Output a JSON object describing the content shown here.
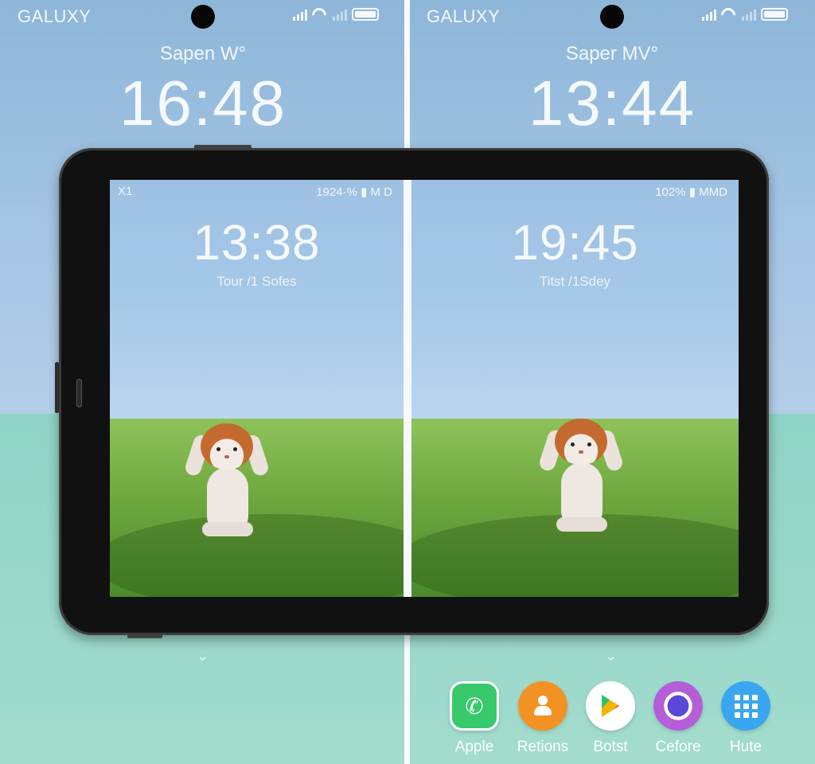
{
  "left_phone": {
    "brand": "GALUXY",
    "owner": "Sapen W°",
    "time": "16:48"
  },
  "right_phone": {
    "brand": "GALUXY",
    "owner": "Saper MV°",
    "time": "13:44"
  },
  "tablet": {
    "left_screen": {
      "status_left": "X1",
      "status_right": "1924·% ▮ M D",
      "time": "13:38",
      "date": "Tour /1 Sofes"
    },
    "right_screen": {
      "status_right": "102% ▮ MMD",
      "time": "19:45",
      "date": "Titst /1Sdey"
    }
  },
  "dock": {
    "apps": [
      {
        "label": "Apple",
        "icon": "phone-icon",
        "color": "#37c96b"
      },
      {
        "label": "Retions",
        "icon": "contacts-icon",
        "color": "#f29224"
      },
      {
        "label": "Botst",
        "icon": "play-store-icon",
        "color": "#ffffff"
      },
      {
        "label": "Cefore",
        "icon": "camera-icon",
        "color": "#b45ed8"
      },
      {
        "label": "Hute",
        "icon": "apps-grid-icon",
        "color": "#3aa6ef"
      }
    ]
  },
  "chevron_glyph": "⌄"
}
